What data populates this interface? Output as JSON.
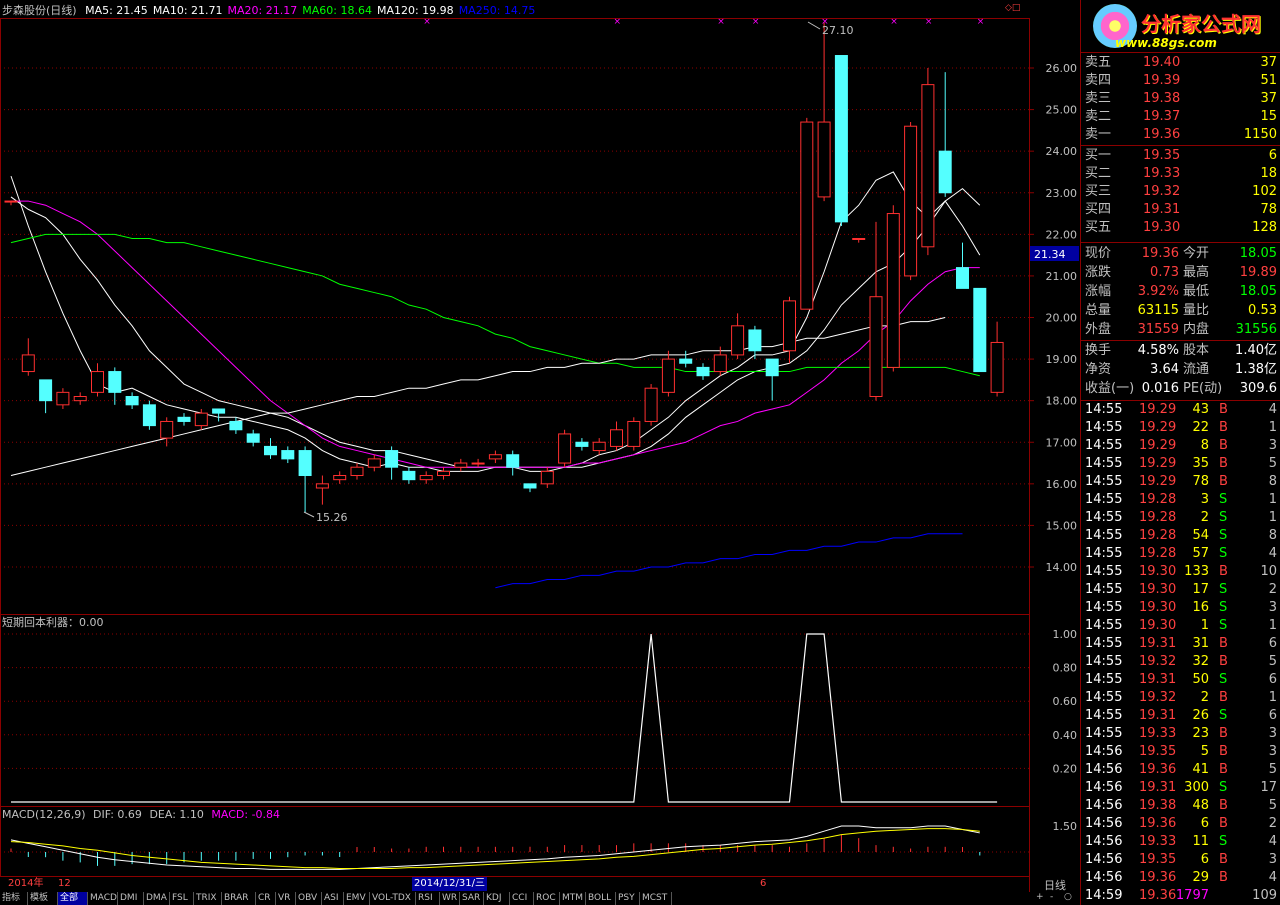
{
  "header": {
    "stock": "步森股份(日线)",
    "ma": [
      {
        "label": "MA5: 21.45",
        "color": "#ffffff"
      },
      {
        "label": "MA10: 21.71",
        "color": "#ffffff"
      },
      {
        "label": "MA20: 21.17",
        "color": "#ff00ff"
      },
      {
        "label": "MA60: 18.64",
        "color": "#00ff00"
      },
      {
        "label": "MA120: 19.98",
        "color": "#ffffff"
      },
      {
        "label": "MA250: 14.75",
        "color": "#0000ff"
      }
    ]
  },
  "main_axis": {
    "ticks": [
      "26.00",
      "25.00",
      "24.00",
      "23.00",
      "22.00",
      "21.00",
      "20.00",
      "19.00",
      "18.00",
      "17.00",
      "16.00",
      "15.00",
      "14.00"
    ],
    "current_marker": "21.34"
  },
  "annotations": {
    "high": "27.10",
    "low": "15.26"
  },
  "indicator": {
    "title": "短期回本利器：0.00",
    "ticks": [
      "1.00",
      "0.80",
      "0.60",
      "0.40",
      "0.20"
    ]
  },
  "macd": {
    "label": "MACD(12,26,9)",
    "dif": "DIF: 0.69",
    "dea": "DEA: 1.10",
    "macd": "MACD: -0.84",
    "tick": "1.50"
  },
  "timeline": {
    "year": "2014年",
    "m12": "12",
    "selected": "2014/12/31/三",
    "m6": "6",
    "period": "日线"
  },
  "chart_data": {
    "type": "candlestick",
    "ylim": [
      13.5,
      27.3
    ],
    "candles": [
      [
        22.8,
        22.8,
        22.8,
        22.7
      ],
      [
        18.7,
        19.1,
        19.5,
        18.6
      ],
      [
        18.5,
        18.0,
        18.5,
        17.7
      ],
      [
        17.9,
        18.2,
        18.3,
        17.8
      ],
      [
        18.0,
        18.1,
        18.2,
        17.9
      ],
      [
        18.2,
        18.7,
        18.9,
        18.1
      ],
      [
        18.7,
        18.2,
        18.8,
        17.9
      ],
      [
        18.1,
        17.9,
        18.2,
        17.8
      ],
      [
        17.9,
        17.4,
        18.0,
        17.3
      ],
      [
        17.1,
        17.5,
        17.6,
        16.9
      ],
      [
        17.6,
        17.5,
        17.7,
        17.4
      ],
      [
        17.4,
        17.7,
        17.8,
        17.3
      ],
      [
        17.8,
        17.7,
        17.8,
        17.5
      ],
      [
        17.5,
        17.3,
        17.6,
        17.2
      ],
      [
        17.2,
        17.0,
        17.3,
        16.9
      ],
      [
        16.9,
        16.7,
        17.1,
        16.6
      ],
      [
        16.8,
        16.6,
        16.9,
        16.5
      ],
      [
        16.8,
        16.2,
        16.9,
        15.3
      ],
      [
        15.9,
        16.0,
        16.2,
        15.5
      ],
      [
        16.1,
        16.2,
        16.3,
        16.0
      ],
      [
        16.2,
        16.4,
        16.5,
        16.1
      ],
      [
        16.4,
        16.6,
        16.7,
        16.3
      ],
      [
        16.8,
        16.4,
        16.9,
        16.1
      ],
      [
        16.3,
        16.1,
        16.4,
        16.0
      ],
      [
        16.1,
        16.2,
        16.3,
        16.0
      ],
      [
        16.2,
        16.3,
        16.4,
        16.1
      ],
      [
        16.4,
        16.5,
        16.6,
        16.3
      ],
      [
        16.5,
        16.5,
        16.6,
        16.4
      ],
      [
        16.6,
        16.7,
        16.8,
        16.5
      ],
      [
        16.7,
        16.4,
        16.8,
        16.2
      ],
      [
        16.0,
        15.9,
        16.0,
        15.8
      ],
      [
        16.0,
        16.3,
        16.4,
        15.9
      ],
      [
        16.5,
        17.2,
        17.3,
        16.4
      ],
      [
        17.0,
        16.9,
        17.1,
        16.8
      ],
      [
        16.8,
        17.0,
        17.1,
        16.7
      ],
      [
        16.9,
        17.3,
        17.5,
        16.8
      ],
      [
        16.9,
        17.5,
        17.6,
        16.8
      ],
      [
        17.5,
        18.3,
        18.4,
        17.4
      ],
      [
        18.2,
        19.0,
        19.2,
        18.1
      ],
      [
        19.0,
        18.9,
        19.2,
        18.8
      ],
      [
        18.8,
        18.6,
        18.9,
        18.5
      ],
      [
        18.7,
        19.1,
        19.3,
        18.6
      ],
      [
        19.1,
        19.8,
        20.1,
        19.0
      ],
      [
        19.7,
        19.2,
        19.8,
        19.0
      ],
      [
        19.0,
        18.6,
        19.0,
        18.0
      ],
      [
        19.2,
        20.4,
        20.5,
        18.9
      ],
      [
        20.2,
        24.7,
        24.8,
        20.2
      ],
      [
        22.9,
        24.7,
        27.1,
        22.8
      ],
      [
        26.3,
        22.3,
        26.3,
        22.2
      ],
      [
        21.9,
        21.9,
        21.9,
        21.8
      ],
      [
        18.1,
        20.5,
        22.3,
        18.0
      ],
      [
        18.8,
        22.5,
        22.7,
        18.7
      ],
      [
        21.0,
        24.6,
        24.7,
        20.9
      ],
      [
        21.7,
        25.6,
        26.0,
        21.5
      ],
      [
        24.0,
        23.0,
        25.9,
        22.9
      ],
      [
        21.2,
        20.7,
        21.8,
        20.7
      ],
      [
        20.7,
        18.7,
        20.6,
        18.7
      ],
      [
        18.2,
        19.4,
        19.9,
        18.1
      ]
    ],
    "ma_lines": [
      {
        "name": "MA5",
        "color": "#ffffff",
        "y": [
          23.4,
          22.2,
          21.1,
          20.1,
          19.2,
          18.4,
          18.2,
          18.3,
          18.1,
          17.9,
          17.8,
          17.7,
          17.6,
          17.6,
          17.5,
          17.4,
          17.3,
          17.1,
          16.8,
          16.6,
          16.5,
          16.4,
          16.5,
          16.4,
          16.4,
          16.3,
          16.3,
          16.3,
          16.4,
          16.4,
          16.3,
          16.3,
          16.4,
          16.5,
          16.7,
          16.8,
          17.0,
          17.3,
          17.6,
          18.0,
          18.3,
          18.6,
          18.8,
          19.1,
          19.1,
          19.2,
          20.0,
          21.1,
          22.3,
          22.7,
          23.3,
          23.5,
          22.8,
          22.4,
          22.8,
          22.2,
          21.5
        ]
      },
      {
        "name": "MA10",
        "color": "#ffffff",
        "y": [
          22.9,
          22.6,
          22.4,
          22.0,
          21.4,
          20.9,
          20.3,
          19.8,
          19.2,
          18.8,
          18.4,
          18.2,
          18.0,
          17.9,
          17.8,
          17.7,
          17.6,
          17.4,
          17.2,
          17.0,
          16.9,
          16.8,
          16.8,
          16.7,
          16.6,
          16.5,
          16.4,
          16.4,
          16.4,
          16.4,
          16.4,
          16.4,
          16.4,
          16.4,
          16.5,
          16.6,
          16.7,
          16.9,
          17.2,
          17.6,
          17.9,
          18.2,
          18.5,
          18.7,
          18.8,
          18.9,
          19.2,
          19.7,
          20.3,
          20.7,
          21.1,
          21.3,
          21.7,
          22.2,
          22.8,
          23.1,
          22.7
        ]
      },
      {
        "name": "MA20",
        "color": "#ff00ff",
        "y": [
          22.8,
          22.8,
          22.7,
          22.5,
          22.3,
          22.0,
          21.6,
          21.2,
          20.8,
          20.4,
          20.0,
          19.6,
          19.2,
          18.8,
          18.4,
          18.0,
          17.7,
          17.4,
          17.1,
          16.9,
          16.8,
          16.7,
          16.6,
          16.5,
          16.4,
          16.4,
          16.4,
          16.4,
          16.4,
          16.4,
          16.4,
          16.4,
          16.4,
          16.5,
          16.5,
          16.6,
          16.7,
          16.8,
          16.9,
          17.0,
          17.2,
          17.4,
          17.5,
          17.7,
          17.8,
          17.9,
          18.2,
          18.5,
          18.9,
          19.2,
          19.6,
          19.9,
          20.4,
          20.8,
          21.1,
          21.2,
          21.2
        ]
      },
      {
        "name": "MA60",
        "color": "#00ff00",
        "y": [
          21.8,
          21.9,
          22.0,
          22.0,
          22.0,
          22.0,
          22.0,
          21.9,
          21.9,
          21.8,
          21.8,
          21.7,
          21.6,
          21.5,
          21.4,
          21.3,
          21.2,
          21.1,
          21.0,
          20.8,
          20.7,
          20.6,
          20.5,
          20.3,
          20.2,
          20.0,
          19.9,
          19.8,
          19.6,
          19.5,
          19.3,
          19.2,
          19.1,
          19.0,
          18.9,
          18.9,
          18.8,
          18.8,
          18.8,
          18.7,
          18.7,
          18.7,
          18.7,
          18.7,
          18.7,
          18.7,
          18.8,
          18.8,
          18.8,
          18.8,
          18.8,
          18.8,
          18.8,
          18.8,
          18.8,
          18.7,
          18.6
        ]
      },
      {
        "name": "MA120",
        "color": "#ffffff",
        "y": [
          16.2,
          16.3,
          16.4,
          16.5,
          16.6,
          16.7,
          16.8,
          16.9,
          17.0,
          17.1,
          17.2,
          17.3,
          17.4,
          17.5,
          17.6,
          17.7,
          17.7,
          17.8,
          17.9,
          18.0,
          18.1,
          18.1,
          18.2,
          18.3,
          18.3,
          18.4,
          18.5,
          18.5,
          18.6,
          18.7,
          18.7,
          18.8,
          18.8,
          18.9,
          18.9,
          19.0,
          19.0,
          19.1,
          19.1,
          19.1,
          19.2,
          19.2,
          19.2,
          19.3,
          19.3,
          19.4,
          19.5,
          19.5,
          19.6,
          19.7,
          19.8,
          19.8,
          19.9,
          19.9,
          20.0
        ]
      },
      {
        "name": "MA250",
        "color": "#0000ff",
        "x0": 28,
        "y": [
          13.5,
          13.6,
          13.6,
          13.7,
          13.7,
          13.8,
          13.8,
          13.9,
          13.9,
          14.0,
          14.0,
          14.1,
          14.1,
          14.2,
          14.2,
          14.3,
          14.3,
          14.4,
          14.4,
          14.5,
          14.5,
          14.6,
          14.6,
          14.7,
          14.7,
          14.8,
          14.8,
          14.8
        ]
      }
    ],
    "indicator_series": {
      "ylim": [
        0,
        1.1
      ],
      "y": [
        0,
        0,
        0,
        0,
        0,
        0,
        0,
        0,
        0,
        0,
        0,
        0,
        0,
        0,
        0,
        0,
        0,
        0,
        0,
        0,
        0,
        0,
        0,
        0,
        0,
        0,
        0,
        0,
        0,
        0,
        0,
        0,
        0,
        0,
        0,
        0,
        0,
        1,
        0,
        0,
        0,
        0,
        0,
        0,
        0,
        0,
        1,
        1,
        0,
        0,
        0,
        0,
        0,
        0,
        0,
        0,
        0,
        0
      ]
    },
    "macd_series": {
      "ylim": [
        -1.6,
        1.8
      ],
      "dif": [
        0.7,
        0.5,
        0.3,
        0.1,
        -0.1,
        -0.3,
        -0.45,
        -0.55,
        -0.65,
        -0.75,
        -0.8,
        -0.85,
        -0.9,
        -0.95,
        -0.95,
        -1.0,
        -1.0,
        -1.0,
        -1.0,
        -1.0,
        -0.95,
        -0.9,
        -0.85,
        -0.8,
        -0.75,
        -0.7,
        -0.65,
        -0.6,
        -0.55,
        -0.5,
        -0.45,
        -0.4,
        -0.3,
        -0.25,
        -0.2,
        -0.1,
        0.0,
        0.1,
        0.2,
        0.3,
        0.35,
        0.4,
        0.5,
        0.6,
        0.65,
        0.7,
        0.9,
        1.2,
        1.5,
        1.5,
        1.4,
        1.4,
        1.4,
        1.5,
        1.5,
        1.3,
        1.1
      ],
      "dea": [
        0.6,
        0.55,
        0.45,
        0.35,
        0.2,
        0.1,
        -0.05,
        -0.2,
        -0.3,
        -0.4,
        -0.5,
        -0.6,
        -0.65,
        -0.7,
        -0.75,
        -0.8,
        -0.85,
        -0.9,
        -0.9,
        -0.95,
        -0.95,
        -0.95,
        -0.95,
        -0.9,
        -0.9,
        -0.85,
        -0.8,
        -0.75,
        -0.7,
        -0.65,
        -0.6,
        -0.55,
        -0.5,
        -0.45,
        -0.4,
        -0.3,
        -0.25,
        -0.15,
        -0.05,
        0.05,
        0.15,
        0.2,
        0.3,
        0.4,
        0.45,
        0.55,
        0.65,
        0.8,
        1.0,
        1.1,
        1.2,
        1.25,
        1.3,
        1.35,
        1.35,
        1.3,
        1.2
      ]
    }
  },
  "logo": {
    "name": "分析家公式网",
    "url": "www.88gs.com"
  },
  "orderbook": {
    "asks": [
      {
        "label": "卖五",
        "price": "19.40",
        "vol": "37"
      },
      {
        "label": "卖四",
        "price": "19.39",
        "vol": "51"
      },
      {
        "label": "卖三",
        "price": "19.38",
        "vol": "37"
      },
      {
        "label": "卖二",
        "price": "19.37",
        "vol": "15"
      },
      {
        "label": "卖一",
        "price": "19.36",
        "vol": "1150"
      }
    ],
    "bids": [
      {
        "label": "买一",
        "price": "19.35",
        "vol": "6"
      },
      {
        "label": "买二",
        "price": "19.33",
        "vol": "18"
      },
      {
        "label": "买三",
        "price": "19.32",
        "vol": "102"
      },
      {
        "label": "买四",
        "price": "19.31",
        "vol": "78"
      },
      {
        "label": "买五",
        "price": "19.30",
        "vol": "128"
      }
    ]
  },
  "quote": [
    {
      "l1": "现价",
      "v1": "19.36",
      "c1": "#ff4040",
      "l2": "今开",
      "v2": "18.05",
      "c2": "#00ff00"
    },
    {
      "l1": "涨跌",
      "v1": "0.73",
      "c1": "#ff4040",
      "l2": "最高",
      "v2": "19.89",
      "c2": "#ff4040"
    },
    {
      "l1": "涨幅",
      "v1": "3.92%",
      "c1": "#ff4040",
      "l2": "最低",
      "v2": "18.05",
      "c2": "#00ff00"
    },
    {
      "l1": "总量",
      "v1": "63115",
      "c1": "#ffff00",
      "l2": "量比",
      "v2": "0.53",
      "c2": "#ffff00"
    },
    {
      "l1": "外盘",
      "v1": "31559",
      "c1": "#ff4040",
      "l2": "内盘",
      "v2": "31556",
      "c2": "#00ff00"
    }
  ],
  "stats": [
    {
      "l1": "换手",
      "v1": "4.58%",
      "l2": "股本",
      "v2": "1.40亿"
    },
    {
      "l1": "净资",
      "v1": "3.64",
      "l2": "流通",
      "v2": "1.38亿"
    },
    {
      "l1": "收益(一)",
      "v1": "0.016",
      "l2": "PE(动)",
      "v2": "309.6"
    }
  ],
  "ticks": [
    {
      "t": "14:55",
      "p": "19.29",
      "v": "43",
      "s": "B",
      "n": "4"
    },
    {
      "t": "14:55",
      "p": "19.29",
      "v": "22",
      "s": "B",
      "n": "1"
    },
    {
      "t": "14:55",
      "p": "19.29",
      "v": "8",
      "s": "B",
      "n": "3"
    },
    {
      "t": "14:55",
      "p": "19.29",
      "v": "35",
      "s": "B",
      "n": "5"
    },
    {
      "t": "14:55",
      "p": "19.29",
      "v": "78",
      "s": "B",
      "n": "8"
    },
    {
      "t": "14:55",
      "p": "19.28",
      "v": "3",
      "s": "S",
      "n": "1"
    },
    {
      "t": "14:55",
      "p": "19.28",
      "v": "2",
      "s": "S",
      "n": "1"
    },
    {
      "t": "14:55",
      "p": "19.28",
      "v": "54",
      "s": "S",
      "n": "8"
    },
    {
      "t": "14:55",
      "p": "19.28",
      "v": "57",
      "s": "S",
      "n": "4"
    },
    {
      "t": "14:55",
      "p": "19.30",
      "v": "133",
      "s": "B",
      "n": "10"
    },
    {
      "t": "14:55",
      "p": "19.30",
      "v": "17",
      "s": "S",
      "n": "2"
    },
    {
      "t": "14:55",
      "p": "19.30",
      "v": "16",
      "s": "S",
      "n": "3"
    },
    {
      "t": "14:55",
      "p": "19.30",
      "v": "1",
      "s": "S",
      "n": "1"
    },
    {
      "t": "14:55",
      "p": "19.31",
      "v": "31",
      "s": "B",
      "n": "6"
    },
    {
      "t": "14:55",
      "p": "19.32",
      "v": "32",
      "s": "B",
      "n": "5"
    },
    {
      "t": "14:55",
      "p": "19.31",
      "v": "50",
      "s": "S",
      "n": "6"
    },
    {
      "t": "14:55",
      "p": "19.32",
      "v": "2",
      "s": "B",
      "n": "1"
    },
    {
      "t": "14:55",
      "p": "19.31",
      "v": "26",
      "s": "S",
      "n": "6"
    },
    {
      "t": "14:55",
      "p": "19.33",
      "v": "23",
      "s": "B",
      "n": "3"
    },
    {
      "t": "14:56",
      "p": "19.35",
      "v": "5",
      "s": "B",
      "n": "3"
    },
    {
      "t": "14:56",
      "p": "19.36",
      "v": "41",
      "s": "B",
      "n": "5"
    },
    {
      "t": "14:56",
      "p": "19.31",
      "v": "300",
      "s": "S",
      "n": "17"
    },
    {
      "t": "14:56",
      "p": "19.38",
      "v": "48",
      "s": "B",
      "n": "5"
    },
    {
      "t": "14:56",
      "p": "19.36",
      "v": "6",
      "s": "B",
      "n": "2"
    },
    {
      "t": "14:56",
      "p": "19.33",
      "v": "11",
      "s": "S",
      "n": "4"
    },
    {
      "t": "14:56",
      "p": "19.35",
      "v": "6",
      "s": "B",
      "n": "3"
    },
    {
      "t": "14:56",
      "p": "19.36",
      "v": "29",
      "s": "B",
      "n": "4"
    },
    {
      "t": "14:59",
      "p": "19.36",
      "v": "1797",
      "s": "",
      "n": "109"
    }
  ],
  "tabs": [
    "指标",
    "模板",
    "全部",
    "MACD",
    "DMI",
    "DMA",
    "FSL",
    "TRIX",
    "BRAR",
    "CR",
    "VR",
    "OBV",
    "ASI",
    "EMV",
    "VOL-TDX",
    "RSI",
    "WR",
    "SAR",
    "KDJ",
    "CCI",
    "ROC",
    "MTM",
    "BOLL",
    "PSY",
    "MCST"
  ],
  "tab_controls": [
    "+",
    "-",
    "○"
  ],
  "colors": {
    "up": "#ff3030",
    "down": "#54ffff",
    "frame": "#8b0000",
    "accent_blue": "#0000a0"
  }
}
